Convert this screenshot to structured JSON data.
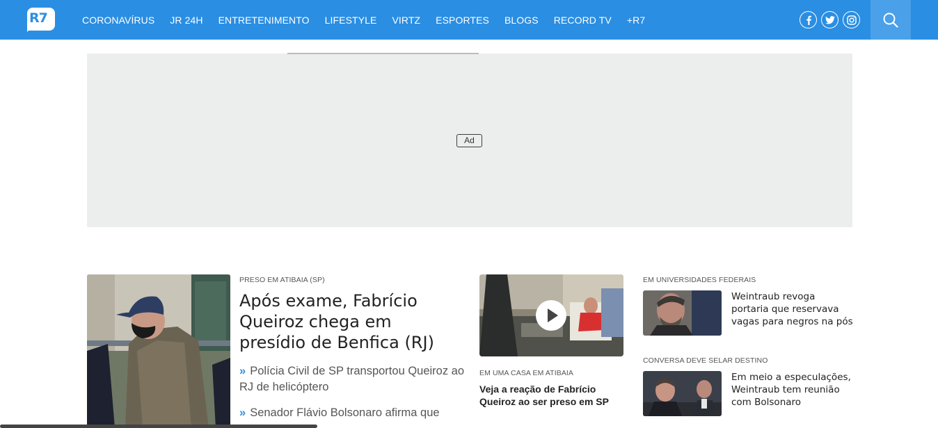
{
  "header": {
    "logo_text": "R7",
    "nav": [
      "CORONAVÍRUS",
      "JR 24H",
      "ENTRETENIMENTO",
      "LIFESTYLE",
      "VIRTZ",
      "ESPORTES",
      "BLOGS",
      "RECORD TV",
      "+R7"
    ],
    "social_icons": [
      "facebook-icon",
      "twitter-icon",
      "instagram-icon"
    ],
    "search_icon": "search-icon",
    "colors": {
      "brand": "#2a8ee3",
      "search_bg": "#4aa0e9"
    }
  },
  "ad": {
    "label": "Ad"
  },
  "main_story": {
    "kicker": "PRESO EM ATIBAIA (SP)",
    "title": "Após exame, Fabrício Queiroz chega em presídio de Benfica (RJ)",
    "related": [
      "Polícia Civil de SP transportou Queiroz ao RJ de helicóptero",
      "Senador Flávio Bolsonaro afirma que"
    ]
  },
  "video_story": {
    "kicker": "EM UMA CASA EM ATIBAIA",
    "title": "Veja a reação de Fabrício Queiroz ao ser preso em SP",
    "play_icon": "play-icon"
  },
  "right_stories": [
    {
      "kicker": "EM UNIVERSIDADES FEDERAIS",
      "title": "Weintraub revoga portaria que reservava vagas para negros na pós"
    },
    {
      "kicker": "CONVERSA DEVE SELAR DESTINO",
      "title": "Em meio a especulações, Weintraub tem reunião com Bolsonaro"
    }
  ]
}
